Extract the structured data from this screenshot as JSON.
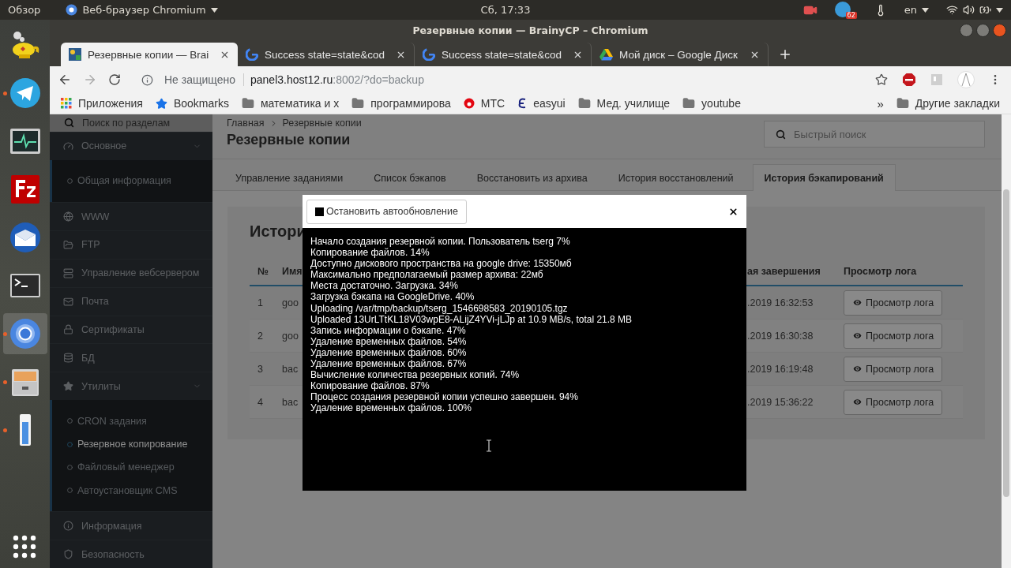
{
  "top_bar": {
    "activities": "Обзор",
    "app_menu": "Веб-браузер Chromium",
    "clock": "Сб, 17:33",
    "badge": "62",
    "language": "en"
  },
  "dock": {
    "items": [
      {
        "kind": "lamp",
        "running": false,
        "selected": false
      },
      {
        "kind": "telegram",
        "running": true,
        "selected": false
      },
      {
        "kind": "monitor",
        "running": false,
        "selected": false
      },
      {
        "kind": "filezilla",
        "running": false,
        "selected": false
      },
      {
        "kind": "thunderbird",
        "running": false,
        "selected": false
      },
      {
        "kind": "terminal",
        "running": false,
        "selected": false
      },
      {
        "kind": "chromium",
        "running": true,
        "selected": true
      },
      {
        "kind": "files",
        "running": true,
        "selected": false
      },
      {
        "kind": "thermometer",
        "running": true,
        "selected": false
      }
    ]
  },
  "window": {
    "title": "Резервные копии — BrainyCP – Chromium"
  },
  "tabs": [
    {
      "kind": "panel",
      "label": "Резервные копии — Brai",
      "selected": true
    },
    {
      "kind": "google",
      "label": "Success state=state&cod",
      "selected": false
    },
    {
      "kind": "google",
      "label": "Success state=state&cod",
      "selected": false
    },
    {
      "kind": "drive",
      "label": "Мой диск – Google Диск",
      "selected": false
    }
  ],
  "toolbar": {
    "security": "Не защищено",
    "url_host": "panel3.host12.ru",
    "url_path": ":8002/?do=backup"
  },
  "bookmarks": {
    "items": [
      {
        "kind": "apps",
        "label": "Приложения"
      },
      {
        "kind": "star",
        "label": "Bookmarks"
      },
      {
        "kind": "folder",
        "label": "математика и х"
      },
      {
        "kind": "folder",
        "label": "программирова"
      },
      {
        "kind": "mts",
        "label": "МТС"
      },
      {
        "kind": "easyui",
        "label": "easyui"
      },
      {
        "kind": "folder",
        "label": "Мед. училище"
      },
      {
        "kind": "folder",
        "label": "youtube"
      }
    ],
    "more": "»",
    "other": "Другие закладки"
  },
  "sidebar": {
    "search": {
      "placeholder": "Поиск по разделам"
    },
    "items": [
      {
        "kind": "gauge",
        "label": "Основное",
        "expanded": true,
        "children": [
          {
            "label": "Общая информация",
            "selected": false
          }
        ]
      },
      {
        "kind": "globe",
        "label": "WWW"
      },
      {
        "kind": "folder",
        "label": "FTP"
      },
      {
        "kind": "server",
        "label": "Управление вебсервером"
      },
      {
        "kind": "mail",
        "label": "Почта"
      },
      {
        "kind": "lock",
        "label": "Сертификаты"
      },
      {
        "kind": "database",
        "label": "БД"
      },
      {
        "kind": "star",
        "label": "Утилиты",
        "expanded": true,
        "children": [
          {
            "label": "CRON задания",
            "selected": false
          },
          {
            "label": "Резервное копирование",
            "selected": true
          },
          {
            "label": "Файловый менеджер",
            "selected": false
          },
          {
            "label": "Автоустановщик CMS",
            "selected": false
          }
        ]
      },
      {
        "kind": "info",
        "label": "Информация"
      },
      {
        "kind": "shield",
        "label": "Безопасность"
      }
    ]
  },
  "page": {
    "breadcrumb": [
      "Главная",
      "Резервные копии"
    ],
    "title": "Резервные копии",
    "quick_search": {
      "placeholder": "Быстрый поиск"
    },
    "tabs": [
      {
        "label": "Управление заданиями",
        "selected": false
      },
      {
        "label": "Список бэкапов",
        "selected": false
      },
      {
        "label": "Восстановить из архива",
        "selected": false
      },
      {
        "label": "История восстановлений",
        "selected": false
      },
      {
        "label": "История бэкапирований",
        "selected": true
      }
    ],
    "card_title": "Истори",
    "table": {
      "columns": [
        "№",
        "Имя",
        "ая завершения",
        "Просмотр лога"
      ],
      "rows": [
        {
          "num": "1",
          "name": "goo",
          "date": ".2019 16:32:53",
          "action": "Просмотр лога"
        },
        {
          "num": "2",
          "name": "goo",
          "date": ".2019 16:30:38",
          "action": "Просмотр лога"
        },
        {
          "num": "3",
          "name": "bac",
          "date": ".2019 16:19:48",
          "action": "Просмотр лога"
        },
        {
          "num": "4",
          "name": "bac",
          "date": ".2019 15:36:22",
          "action": "Просмотр лога"
        }
      ]
    }
  },
  "modal": {
    "stop_button": "Остановить автообновление",
    "log": [
      "Начало создания резервной копии. Пользователь tserg 7%",
      "Копирование файлов.  14%",
      "Доступно дискового пространства на google drive: 15350мб",
      "Максимально предполагаемый размер архива: 22мб",
      "Места достаточно. Загрузка. 34%",
      "Загрузка бэкапа на GoogleDrive.  40%",
      "Uploading /var/tmp/backup/tserg_1546698583_20190105.tgz",
      "Uploaded 13UrLTtKL18V03wpE8-ALijZ4YVi-jLJp at 10.9 MB/s, total 21.8 MB",
      "Запись информации о бэкапе.  47%",
      "Удаление временных файлов.  54%",
      "Удаление временных файлов.  60%",
      "Удаление временных файлов.  67%",
      "Вычисление количества резервных копий. 74%",
      "Копирование файлов.  87%",
      "Процесс создания резервной копии успешно завершен. 94%",
      "Удаление временных файлов.  100%"
    ]
  }
}
